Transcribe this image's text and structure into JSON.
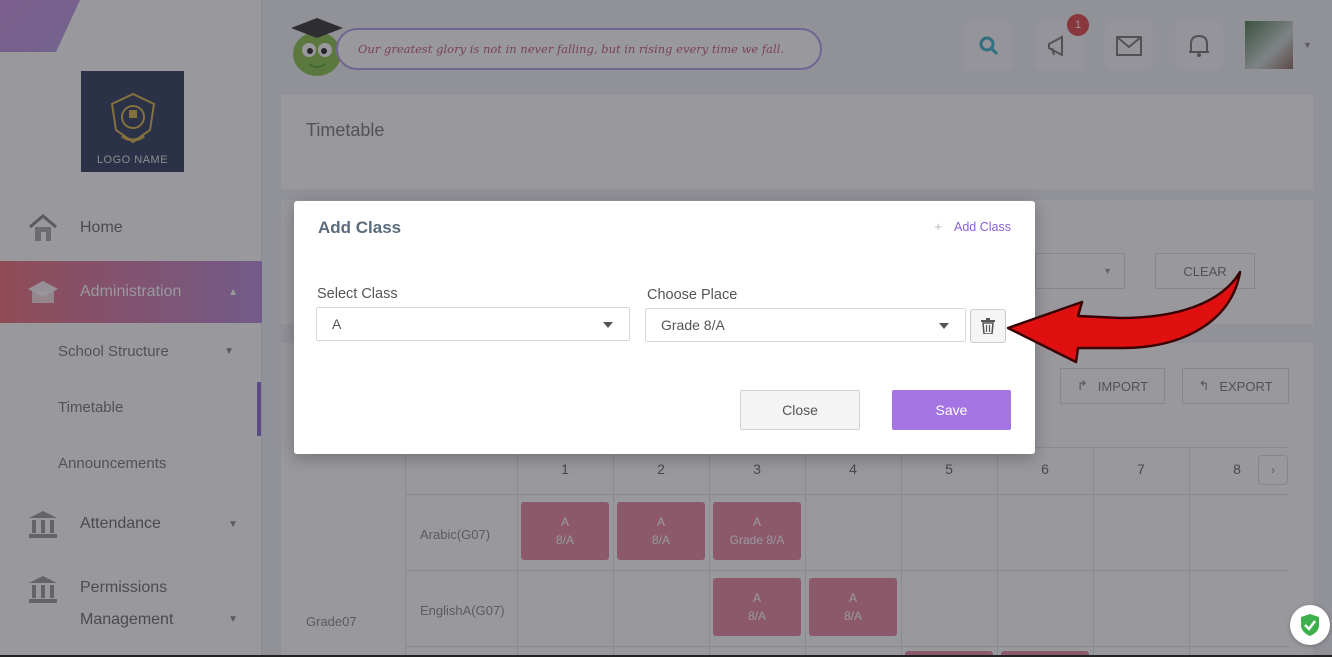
{
  "logo": {
    "text": "LOGO NAME"
  },
  "sidebar": {
    "items": [
      {
        "label": "Home",
        "icon": "home-icon"
      },
      {
        "label": "Administration",
        "icon": "school-icon",
        "active": true
      },
      {
        "label": "Attendance",
        "icon": "bank-icon"
      },
      {
        "label": "Permissions Management",
        "icon": "bank-icon"
      }
    ],
    "sub_items": [
      {
        "label": "School Structure"
      },
      {
        "label": "Timetable",
        "active": true
      },
      {
        "label": "Announcements"
      }
    ]
  },
  "header": {
    "quote": "Our greatest glory is not in never falling, but in rising every time we fall.",
    "notification_count": "1"
  },
  "page": {
    "title": "Timetable",
    "clear_label": "CLEAR",
    "import_label": "IMPORT",
    "export_label": "EXPORT"
  },
  "timetable": {
    "columns": [
      "1",
      "2",
      "3",
      "4",
      "5",
      "6",
      "7",
      "8"
    ],
    "grade": "Grade07",
    "rows": [
      {
        "label": "Arabic(G07)",
        "cells": [
          {
            "col": 1,
            "line1": "A",
            "line2": "8/A"
          },
          {
            "col": 2,
            "line1": "A",
            "line2": "8/A"
          },
          {
            "col": 3,
            "line1": "A",
            "line2": "Grade 8/A"
          }
        ]
      },
      {
        "label": "EnglishA(G07)",
        "cells": [
          {
            "col": 3,
            "line1": "A",
            "line2": "8/A"
          },
          {
            "col": 4,
            "line1": "A",
            "line2": "8/A"
          }
        ]
      }
    ]
  },
  "modal": {
    "title": "Add Class",
    "add_link": "Add Class",
    "select_class_label": "Select Class",
    "select_class_value": "A",
    "choose_place_label": "Choose Place",
    "choose_place_value": "Grade 8/A",
    "close_label": "Close",
    "save_label": "Save"
  },
  "colors": {
    "accent": "#a475e2",
    "active_gradient_start": "#ef6d78",
    "cell_pink": "#e9879f",
    "annotation_arrow": "#e01010"
  }
}
